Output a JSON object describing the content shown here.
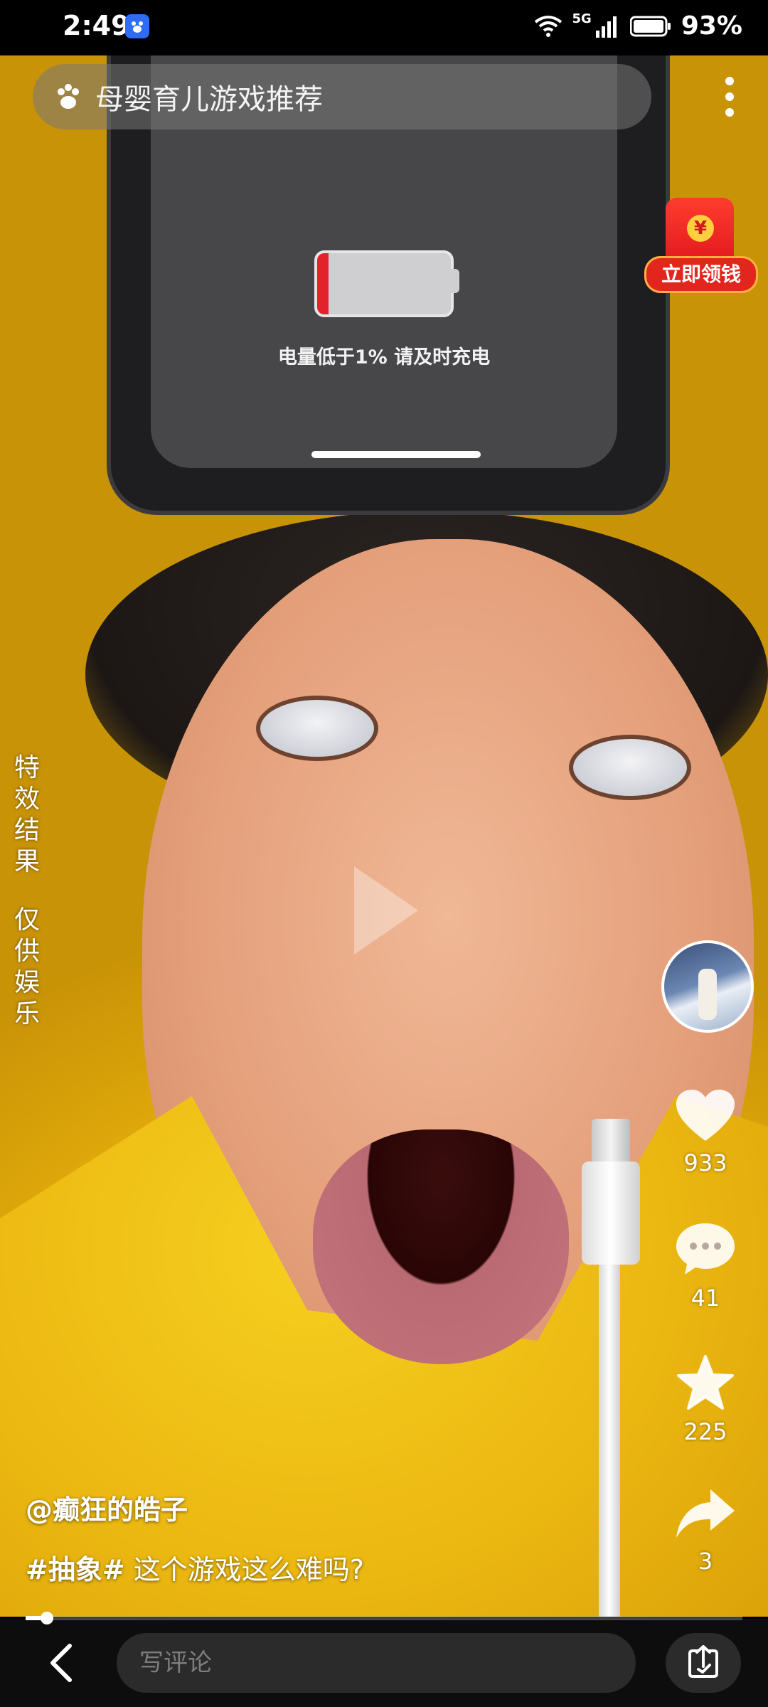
{
  "status_bar": {
    "time": "2:49",
    "network": "5G",
    "battery_percent": "93%"
  },
  "search": {
    "query": "母婴育儿游戏推荐"
  },
  "red_packet": {
    "label": "立即领钱",
    "coin_symbol": "¥"
  },
  "video": {
    "phone_message": "电量低于1% 请及时充电",
    "side_notice_line1": "特效结果",
    "side_notice_line2": "仅供娱乐",
    "progress_fraction": 0.03
  },
  "author": {
    "handle": "@癫狂的皓子"
  },
  "caption": {
    "tag": "#抽象#",
    "text": " 这个游戏这么难吗?"
  },
  "actions": {
    "likes": "933",
    "comments": "41",
    "favorites": "225",
    "shares": "3"
  },
  "bottom_bar": {
    "comment_placeholder": "写评论"
  },
  "icons": [
    "baidu-icon",
    "wifi-icon",
    "signal-icon",
    "battery-icon",
    "paw-icon",
    "more-icon",
    "heart-icon",
    "comment-icon",
    "star-icon",
    "share-icon",
    "back-icon",
    "upload-icon",
    "play-icon"
  ]
}
